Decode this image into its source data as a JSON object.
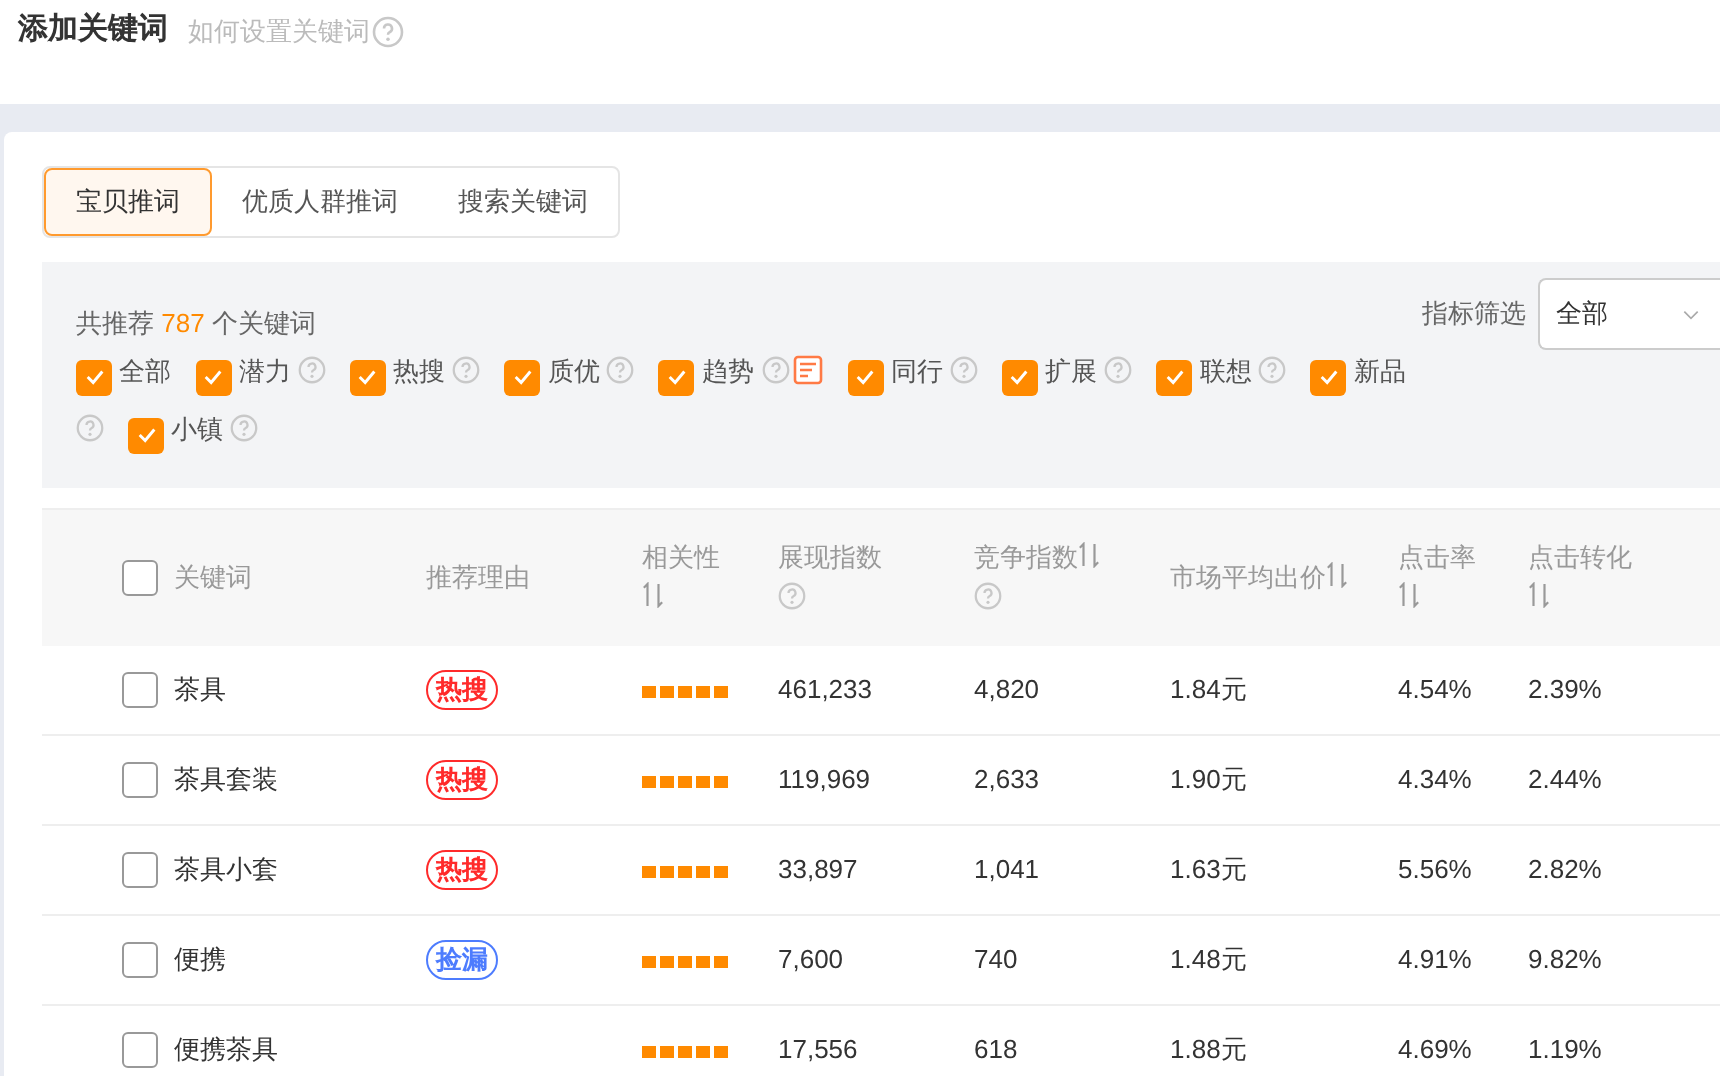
{
  "header": {
    "title": "添加关键词",
    "help_link": "如何设置关键词"
  },
  "tabs": [
    {
      "label": "宝贝推词",
      "selected": true
    },
    {
      "label": "优质人群推词",
      "selected": false
    },
    {
      "label": "搜索关键词",
      "selected": false
    }
  ],
  "filter": {
    "summary_prefix": "共推荐",
    "count": "787",
    "summary_suffix": "个关键词",
    "metric_label": "指标筛选",
    "metric_value": "全部",
    "options": [
      {
        "label": "全部",
        "checked": true,
        "help": false,
        "note": false
      },
      {
        "label": "潜力",
        "checked": true,
        "help": true,
        "note": false
      },
      {
        "label": "热搜",
        "checked": true,
        "help": true,
        "note": false
      },
      {
        "label": "质优",
        "checked": true,
        "help": true,
        "note": false
      },
      {
        "label": "趋势",
        "checked": true,
        "help": true,
        "note": true
      },
      {
        "label": "同行",
        "checked": true,
        "help": true,
        "note": false
      },
      {
        "label": "扩展",
        "checked": true,
        "help": true,
        "note": false
      },
      {
        "label": "联想",
        "checked": true,
        "help": true,
        "note": false
      },
      {
        "label": "新品",
        "checked": true,
        "help": true,
        "note": false
      },
      {
        "label": "小镇",
        "checked": true,
        "help": true,
        "note": false
      }
    ]
  },
  "table": {
    "select_all_checked": false,
    "columns": [
      {
        "label": "关键词",
        "sortable": false,
        "help": false
      },
      {
        "label": "推荐理由",
        "sortable": false,
        "help": false
      },
      {
        "label": "相关性",
        "sortable": true,
        "help": false
      },
      {
        "label": "展现指数",
        "sortable": false,
        "help": true
      },
      {
        "label": "竞争指数",
        "sortable": true,
        "help": true
      },
      {
        "label": "市场平均出价",
        "sortable": true,
        "help": false
      },
      {
        "label": "点击率",
        "sortable": true,
        "help": false
      },
      {
        "label": "点击转化",
        "sortable": true,
        "help": false
      }
    ],
    "rows": [
      {
        "checked": false,
        "keyword": "茶具",
        "tag": {
          "text": "热搜",
          "color": "#ff2a2a"
        },
        "stars": 5,
        "display": "461,233",
        "competition": "4,820",
        "price": "1.84元",
        "ctr": "4.54%",
        "cvr": "2.39%"
      },
      {
        "checked": false,
        "keyword": "茶具套装",
        "tag": {
          "text": "热搜",
          "color": "#ff2a2a"
        },
        "stars": 5,
        "display": "119,969",
        "competition": "2,633",
        "price": "1.90元",
        "ctr": "4.34%",
        "cvr": "2.44%"
      },
      {
        "checked": false,
        "keyword": "茶具小套",
        "tag": {
          "text": "热搜",
          "color": "#ff2a2a"
        },
        "stars": 5,
        "display": "33,897",
        "competition": "1,041",
        "price": "1.63元",
        "ctr": "5.56%",
        "cvr": "2.82%"
      },
      {
        "checked": false,
        "keyword": "便携",
        "tag": {
          "text": "捡漏",
          "color": "#4d7cfe"
        },
        "stars": 5,
        "display": "7,600",
        "competition": "740",
        "price": "1.48元",
        "ctr": "4.91%",
        "cvr": "9.82%"
      },
      {
        "checked": false,
        "keyword": "便携茶具",
        "stars": 5,
        "display": "17,556",
        "competition": "618",
        "price": "1.88元",
        "ctr": "4.69%",
        "cvr": "1.19%"
      }
    ]
  }
}
